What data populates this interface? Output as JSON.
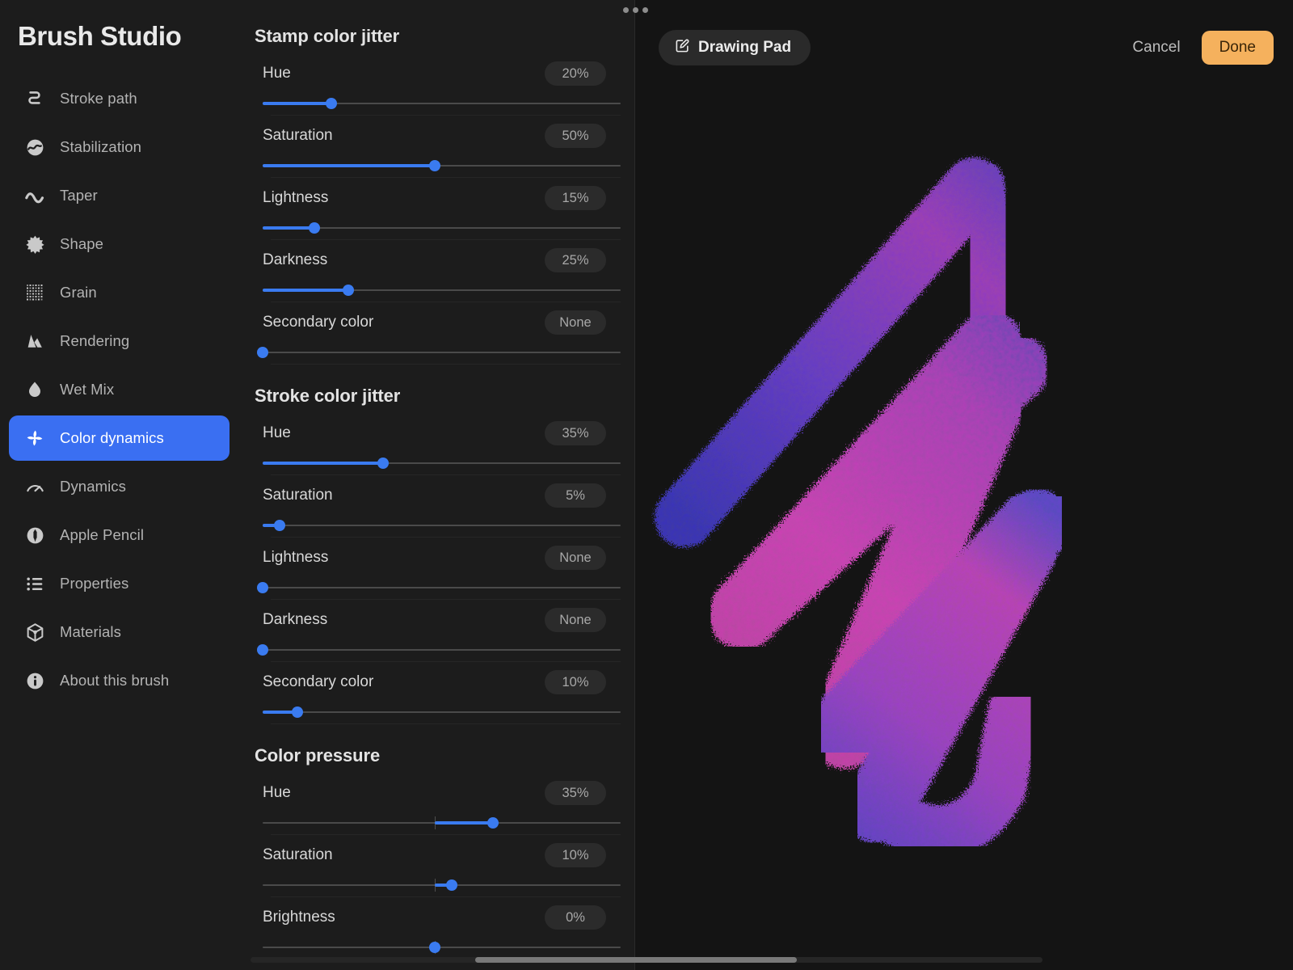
{
  "window": {
    "title": "Brush Studio",
    "drag_handle": "drag-handle-dots"
  },
  "sidebar": {
    "items": [
      {
        "label": "Stroke path",
        "icon": "stroke-path-icon",
        "active": false
      },
      {
        "label": "Stabilization",
        "icon": "stabilization-icon",
        "active": false
      },
      {
        "label": "Taper",
        "icon": "taper-icon",
        "active": false
      },
      {
        "label": "Shape",
        "icon": "shape-star-icon",
        "active": false
      },
      {
        "label": "Grain",
        "icon": "grain-dots-icon",
        "active": false
      },
      {
        "label": "Rendering",
        "icon": "rendering-icon",
        "active": false
      },
      {
        "label": "Wet Mix",
        "icon": "wet-mix-drop-icon",
        "active": false
      },
      {
        "label": "Color dynamics",
        "icon": "color-dynamics-pinwheel-icon",
        "active": true
      },
      {
        "label": "Dynamics",
        "icon": "dynamics-gauge-icon",
        "active": false
      },
      {
        "label": "Apple Pencil",
        "icon": "apple-pencil-icon",
        "active": false
      },
      {
        "label": "Properties",
        "icon": "properties-list-icon",
        "active": false
      },
      {
        "label": "Materials",
        "icon": "materials-cube-icon",
        "active": false
      },
      {
        "label": "About this brush",
        "icon": "info-icon",
        "active": false
      }
    ]
  },
  "settings": {
    "groups": [
      {
        "title": "Stamp color jitter",
        "bipolar": false,
        "rows": [
          {
            "label": "Hue",
            "value": "20%",
            "percent": 20
          },
          {
            "label": "Saturation",
            "value": "50%",
            "percent": 50
          },
          {
            "label": "Lightness",
            "value": "15%",
            "percent": 15
          },
          {
            "label": "Darkness",
            "value": "25%",
            "percent": 25
          },
          {
            "label": "Secondary color",
            "value": "None",
            "percent": 0
          }
        ]
      },
      {
        "title": "Stroke color jitter",
        "bipolar": false,
        "rows": [
          {
            "label": "Hue",
            "value": "35%",
            "percent": 35
          },
          {
            "label": "Saturation",
            "value": "5%",
            "percent": 5
          },
          {
            "label": "Lightness",
            "value": "None",
            "percent": 0
          },
          {
            "label": "Darkness",
            "value": "None",
            "percent": 0
          },
          {
            "label": "Secondary color",
            "value": "10%",
            "percent": 10
          }
        ]
      },
      {
        "title": "Color pressure",
        "bipolar": true,
        "rows": [
          {
            "label": "Hue",
            "value": "35%",
            "percent": 67
          },
          {
            "label": "Saturation",
            "value": "10%",
            "percent": 55
          },
          {
            "label": "Brightness",
            "value": "0%",
            "percent": 50
          }
        ]
      }
    ]
  },
  "preview": {
    "drawing_pad_label": "Drawing Pad",
    "drawing_pad_icon": "edit-square-icon",
    "cancel_label": "Cancel",
    "done_label": "Done"
  },
  "colors": {
    "accent_blue": "#3a7bf0",
    "selection_blue": "#3a6ff2",
    "done_orange": "#f5b15d",
    "panel_bg": "#1c1c1c",
    "canvas_bg": "#141414",
    "stroke_pink": "#c24bb0",
    "stroke_blue": "#4a46b8"
  }
}
